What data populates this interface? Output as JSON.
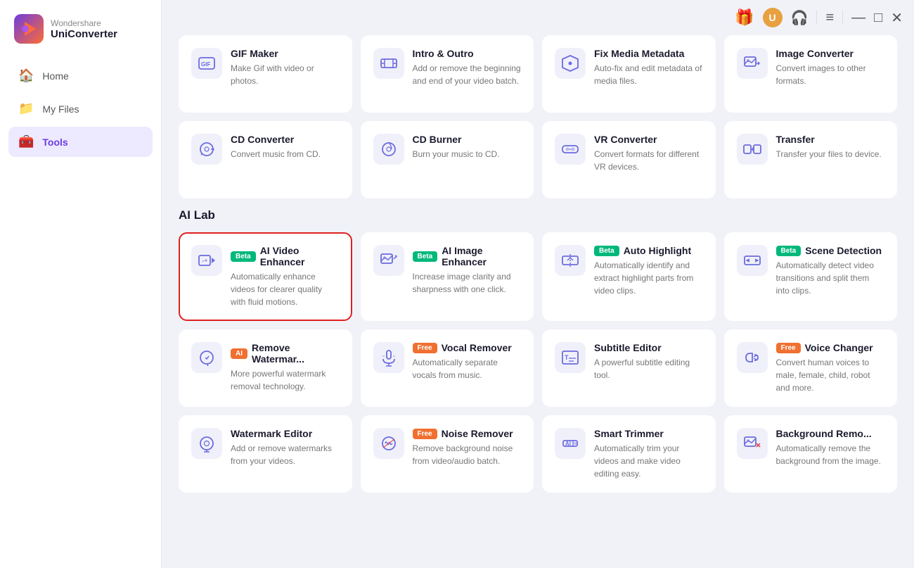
{
  "app": {
    "name": "Wondershare",
    "product": "UniConverter"
  },
  "sidebar": {
    "nav": [
      {
        "id": "home",
        "label": "Home",
        "icon": "🏠",
        "active": false
      },
      {
        "id": "myfiles",
        "label": "My Files",
        "icon": "📁",
        "active": false
      },
      {
        "id": "tools",
        "label": "Tools",
        "icon": "🧰",
        "active": true
      }
    ]
  },
  "topbar": {
    "gift_icon": "🎁",
    "user_initial": "U",
    "headphones_icon": "🎧",
    "menu_icon": "≡",
    "minimize_icon": "—",
    "maximize_icon": "□",
    "close_icon": "✕"
  },
  "sections": [
    {
      "id": "tools-section",
      "cards": [
        {
          "id": "gif-maker",
          "title": "GIF Maker",
          "desc": "Make Gif with video or photos.",
          "icon": "gif",
          "badge": null,
          "highlighted": false
        },
        {
          "id": "intro-outro",
          "title": "Intro & Outro",
          "desc": "Add or remove the beginning and end of your video batch.",
          "icon": "intro",
          "badge": null,
          "highlighted": false
        },
        {
          "id": "fix-media",
          "title": "Fix Media Metadata",
          "desc": "Auto-fix and edit metadata of media files.",
          "icon": "fix",
          "badge": null,
          "highlighted": false
        },
        {
          "id": "image-converter",
          "title": "Image Converter",
          "desc": "Convert images to other formats.",
          "icon": "imgconv",
          "badge": null,
          "highlighted": false
        },
        {
          "id": "cd-converter",
          "title": "CD Converter",
          "desc": "Convert music from CD.",
          "icon": "cd",
          "badge": null,
          "highlighted": false
        },
        {
          "id": "cd-burner",
          "title": "CD Burner",
          "desc": "Burn your music to CD.",
          "icon": "cdb",
          "badge": null,
          "highlighted": false
        },
        {
          "id": "vr-converter",
          "title": "VR Converter",
          "desc": "Convert formats for different VR devices.",
          "icon": "vr",
          "badge": null,
          "highlighted": false
        },
        {
          "id": "transfer",
          "title": "Transfer",
          "desc": "Transfer your files to device.",
          "icon": "transfer",
          "badge": null,
          "highlighted": false
        }
      ]
    },
    {
      "id": "ai-lab-section",
      "title": "AI Lab",
      "cards": [
        {
          "id": "ai-video-enhancer",
          "title": "AI Video Enhancer",
          "desc": "Automatically enhance videos for clearer quality with fluid motions.",
          "icon": "aivideo",
          "badge": "beta",
          "highlighted": true
        },
        {
          "id": "ai-image-enhancer",
          "title": "AI Image Enhancer",
          "desc": "Increase image clarity and sharpness with one click.",
          "icon": "aiimage",
          "badge": "beta",
          "highlighted": false
        },
        {
          "id": "auto-highlight",
          "title": "Auto Highlight",
          "desc": "Automatically identify and extract highlight parts from video clips.",
          "icon": "autohl",
          "badge": "beta",
          "highlighted": false
        },
        {
          "id": "scene-detection",
          "title": "Scene Detection",
          "desc": "Automatically detect video transitions and split them into clips.",
          "icon": "scene",
          "badge": "beta",
          "highlighted": false
        },
        {
          "id": "remove-watermark",
          "title": "Remove Watermar...",
          "desc": "More powerful watermark removal technology.",
          "icon": "watermark",
          "badge": "ai",
          "highlighted": false
        },
        {
          "id": "vocal-remover",
          "title": "Vocal Remover",
          "desc": "Automatically separate vocals from music.",
          "icon": "vocal",
          "badge": "free",
          "highlighted": false
        },
        {
          "id": "subtitle-editor",
          "title": "Subtitle Editor",
          "desc": "A powerful subtitle editing tool.",
          "icon": "subtitle",
          "badge": null,
          "highlighted": false
        },
        {
          "id": "voice-changer",
          "title": "Voice Changer",
          "desc": "Convert human voices to male, female, child, robot and more.",
          "icon": "voice",
          "badge": "free",
          "highlighted": false
        },
        {
          "id": "watermark-editor",
          "title": "Watermark Editor",
          "desc": "Add or remove watermarks from your videos.",
          "icon": "wmeditor",
          "badge": null,
          "highlighted": false
        },
        {
          "id": "noise-remover",
          "title": "Noise Remover",
          "desc": "Remove background noise from video/audio batch.",
          "icon": "noise",
          "badge": "free",
          "highlighted": false
        },
        {
          "id": "smart-trimmer",
          "title": "Smart Trimmer",
          "desc": "Automatically trim your videos and make video editing easy.",
          "icon": "trim",
          "badge": null,
          "highlighted": false
        },
        {
          "id": "background-remover",
          "title": "Background Remo...",
          "desc": "Automatically remove the background from the image.",
          "icon": "bgrm",
          "badge": null,
          "highlighted": false
        }
      ]
    }
  ],
  "badges": {
    "beta": "Beta",
    "ai": "AI",
    "free": "Free"
  }
}
